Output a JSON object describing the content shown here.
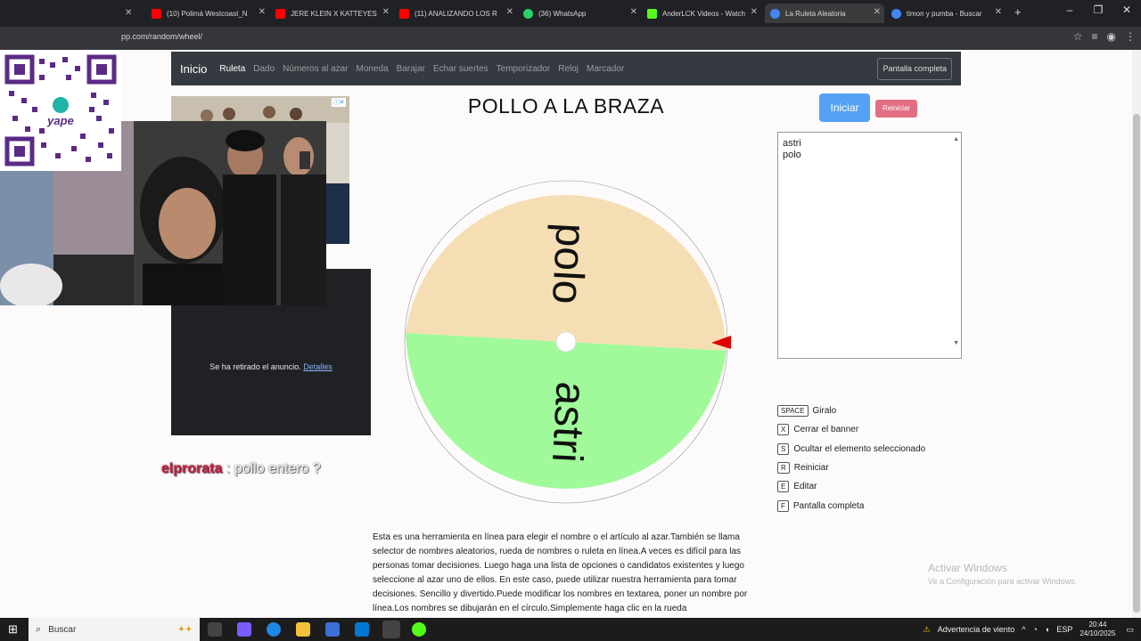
{
  "browser": {
    "tabs": [
      {
        "label": "(10) Polimá Westcoast_N",
        "color": "#ff0000"
      },
      {
        "label": "JERE KLEIN X KATTEYES",
        "color": "#ff0000"
      },
      {
        "label": "(11) ANALIZANDO LOS R",
        "color": "#ff0000"
      },
      {
        "label": "(36) WhatsApp",
        "color": "#25d366"
      },
      {
        "label": "AnderLCK Videos - Watch",
        "color": "#53fc18"
      },
      {
        "label": "La Ruleta Aleatoria",
        "color": "#4285f4"
      },
      {
        "label": "timon y pumba - Buscar",
        "color": "#4285f4"
      }
    ],
    "new_tab": "+",
    "url": "pp.com/random/wheel/"
  },
  "navbar": {
    "brand": "Inicio",
    "links": [
      "Ruleta",
      "Dado",
      "Números al azar",
      "Moneda",
      "Barajar",
      "Echar suertes",
      "Temporizador",
      "Reloj",
      "Marcador"
    ],
    "fullscreen": "Pantalla completa"
  },
  "wheel": {
    "title": "POLLO A LA BRAZA",
    "start_label": "Iniciar",
    "reset_label": "Reiniciar",
    "segments": [
      {
        "label": "polo",
        "color": "#f5deb3"
      },
      {
        "label": "astri",
        "color": "#a0fa9a"
      }
    ],
    "pointer_color": "#e00000",
    "entries_text": "astri\npolo"
  },
  "shortcuts": [
    {
      "key": "SPACE",
      "label": "Giralo"
    },
    {
      "key": "X",
      "label": "Cerrar el banner"
    },
    {
      "key": "S",
      "label": "Ocultar el elemento seleccionado"
    },
    {
      "key": "R",
      "label": "Reiniciar"
    },
    {
      "key": "E",
      "label": "Editar"
    },
    {
      "key": "F",
      "label": "Pantalla completa"
    }
  ],
  "description": "Esta es una herramienta en línea para elegir el nombre o el artículo al azar.También se llama selector de nombres aleatorios, rueda de nombres o ruleta en línea.A veces es difícil para las personas tomar decisiones. Luego haga una lista de opciones o candidatos existentes y luego seleccione al azar uno de ellos. En este caso, puede utilizar nuestra herramienta para tomar decisiones. Sencillo y divertido.Puede modificar los nombres en textarea, poner un nombre por línea.Los nombres se dibujarán en el círculo.Simplemente haga clic en la rueda",
  "ad": {
    "removed_text": "Se ha retirado el anuncio.",
    "details_link": "Detalles"
  },
  "stream": {
    "qr_label": "yape",
    "chat_user": "elprorata",
    "chat_message": ": pollo entero ?"
  },
  "watermark": {
    "line1": "Activar Windows",
    "line2": "Ve a Configuración para activar Windows."
  },
  "taskbar": {
    "search_placeholder": "Buscar",
    "weather_alert": "Advertencia de viento",
    "language": "ESP",
    "time": "20:44",
    "date": "24/10/2025"
  }
}
